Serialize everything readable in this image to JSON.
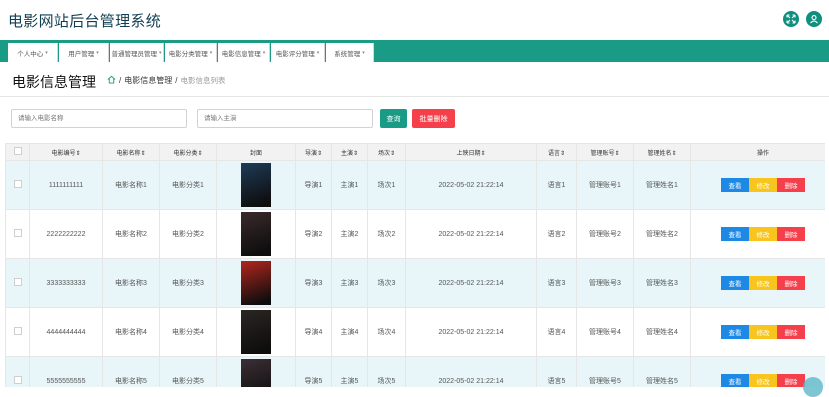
{
  "header": {
    "title": "电影网站后台管理系统",
    "icons": [
      "expand-icon",
      "user-icon"
    ]
  },
  "nav": {
    "items": [
      {
        "label": "个人中心"
      },
      {
        "label": "用户管理"
      },
      {
        "label": "普通管理员管理"
      },
      {
        "label": "电影分类管理"
      },
      {
        "label": "电影信息管理"
      },
      {
        "label": "电影评分管理"
      },
      {
        "label": "系统管理"
      }
    ]
  },
  "page": {
    "title": "电影信息管理",
    "breadcrumb": {
      "level1": "电影信息管理",
      "level2": "电影信息列表",
      "sep": "/"
    }
  },
  "search": {
    "name_placeholder": "请输入电影名称",
    "actor_placeholder": "请输入主演",
    "query_label": "查询",
    "batch_delete_label": "批量删除"
  },
  "table": {
    "headers": [
      "电影编号",
      "电影名称",
      "电影分类",
      "封面",
      "导演",
      "主演",
      "场次",
      "上映日期",
      "语言",
      "管理账号",
      "管理姓名",
      "操作"
    ],
    "rows": [
      {
        "id": "1111111111",
        "name": "电影名称1",
        "category": "电影分类1",
        "director": "导演1",
        "actor": "主演1",
        "session": "场次1",
        "date": "2022-05-02 21:22:14",
        "language": "语言1",
        "account": "管理账号1",
        "manager": "管理姓名1",
        "poster_color": "#1f3b57"
      },
      {
        "id": "2222222222",
        "name": "电影名称2",
        "category": "电影分类2",
        "director": "导演2",
        "actor": "主演2",
        "session": "场次2",
        "date": "2022-05-02 21:22:14",
        "language": "语言2",
        "account": "管理账号2",
        "manager": "管理姓名2",
        "poster_color": "#3a2b2b"
      },
      {
        "id": "3333333333",
        "name": "电影名称3",
        "category": "电影分类3",
        "director": "导演3",
        "actor": "主演3",
        "session": "场次3",
        "date": "2022-05-02 21:22:14",
        "language": "语言3",
        "account": "管理账号3",
        "manager": "管理姓名3",
        "poster_color": "#b3261e"
      },
      {
        "id": "4444444444",
        "name": "电影名称4",
        "category": "电影分类4",
        "director": "导演4",
        "actor": "主演4",
        "session": "场次4",
        "date": "2022-05-02 21:22:14",
        "language": "语言4",
        "account": "管理账号4",
        "manager": "管理姓名4",
        "poster_color": "#2b2622"
      },
      {
        "id": "5555555555",
        "name": "电影名称5",
        "category": "电影分类5",
        "director": "导演5",
        "actor": "主演5",
        "session": "场次5",
        "date": "2022-05-02 21:22:14",
        "language": "语言5",
        "account": "管理账号5",
        "manager": "管理姓名5",
        "poster_color": "#3b2f35"
      }
    ],
    "actions": {
      "view": "查看",
      "edit": "修改",
      "delete": "删除"
    }
  },
  "colors": {
    "nav_bg": "#1a9b85",
    "query_btn": "#1a9b85",
    "batch_delete_btn": "#f5404c",
    "view_btn": "#1e88e5",
    "edit_btn": "#f7c51e",
    "delete_btn": "#f5404c",
    "row_alt": "#e8f6f9"
  }
}
